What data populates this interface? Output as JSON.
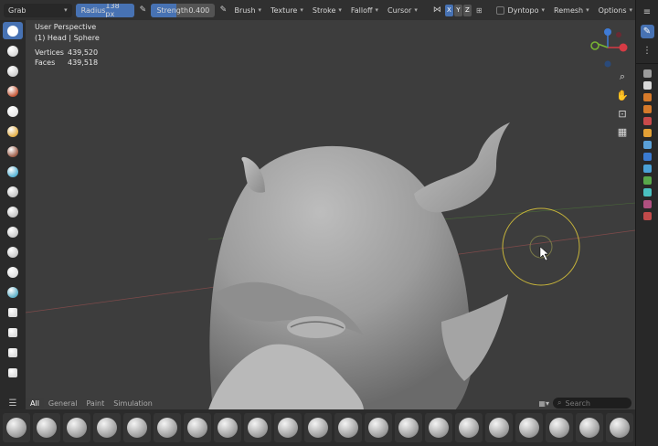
{
  "header": {
    "mode": "Grab",
    "radius_label": "Radius",
    "radius_value": "138 px",
    "strength_label": "Strength",
    "strength_value": "0.400",
    "strength_fraction": 0.4,
    "menus": [
      "Brush",
      "Texture",
      "Stroke",
      "Falloff",
      "Cursor"
    ],
    "axes": [
      "X",
      "Y",
      "Z"
    ],
    "dyntopo_label": "Dyntopo",
    "remesh_label": "Remesh",
    "options_label": "Options"
  },
  "viewport": {
    "perspective": "User Perspective",
    "object": "(1) Head | Sphere",
    "stats": [
      {
        "label": "Vertices",
        "value": "439,520"
      },
      {
        "label": "Faces",
        "value": "439,518"
      }
    ]
  },
  "shelf": {
    "tabs": [
      "All",
      "General",
      "Paint",
      "Simulation"
    ],
    "search_placeholder": "Search"
  },
  "colors": {
    "accent": "#4772b3",
    "viewport_bg": "#3d3d3d",
    "gizmo_x": "#d63b45",
    "gizmo_y": "#79b532",
    "gizmo_z": "#3f7bd6",
    "brush_circle": "#c7b43a"
  },
  "icons": {
    "toolbar": [
      "draw-brush-icon",
      "clay-icon",
      "clay-strips-icon",
      "layer-icon",
      "inflate-icon",
      "blob-icon",
      "crease-icon",
      "smooth-icon",
      "flatten-icon",
      "grab-icon",
      "snake-hook-icon",
      "thumb-icon",
      "pose-icon",
      "mask-icon",
      "move-icon",
      "rotate-icon",
      "scale-icon",
      "transform-icon"
    ],
    "nav": [
      "zoom-icon",
      "hand-icon",
      "camera-icon",
      "grid-icon"
    ]
  }
}
